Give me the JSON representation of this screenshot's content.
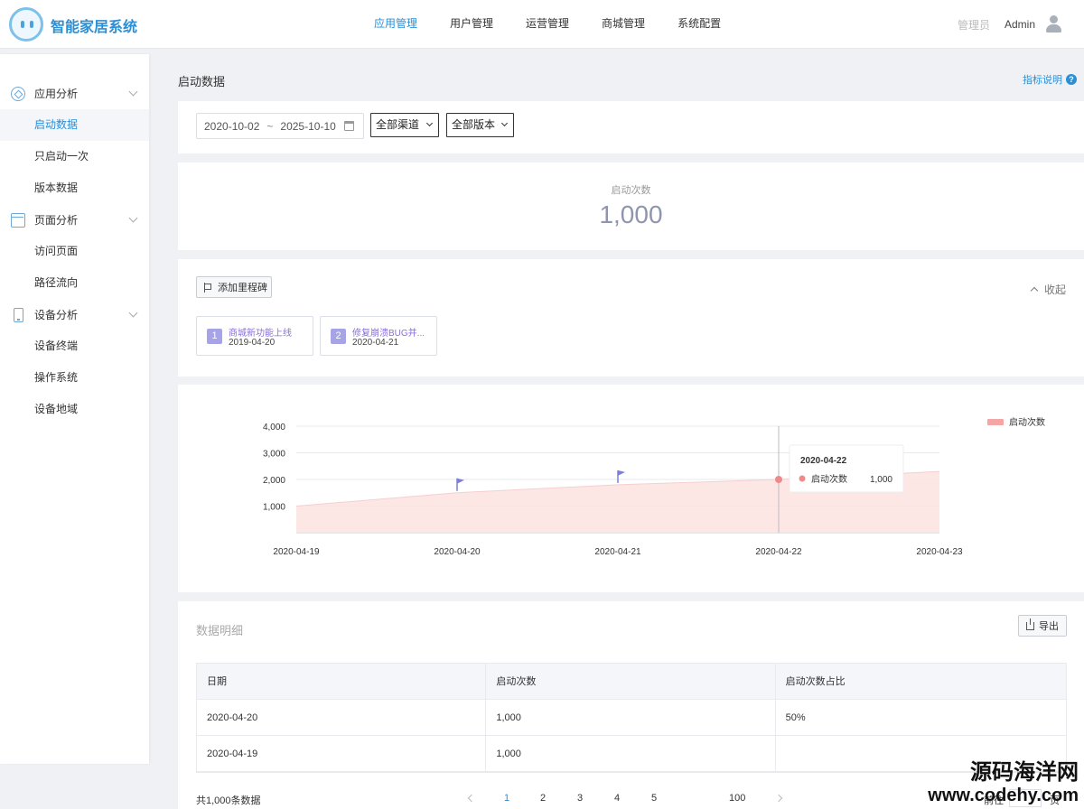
{
  "header": {
    "brand": "智能家居系统",
    "nav": [
      {
        "label": "应用管理",
        "active": true
      },
      {
        "label": "用户管理",
        "active": false
      },
      {
        "label": "运营管理",
        "active": false
      },
      {
        "label": "商城管理",
        "active": false
      },
      {
        "label": "系统配置",
        "active": false
      }
    ],
    "role": "管理员",
    "user": "Admin"
  },
  "sidebar": {
    "groups": [
      {
        "label": "应用分析",
        "icon": "cube-icon",
        "items": [
          "启动数据",
          "只启动一次",
          "版本数据"
        ]
      },
      {
        "label": "页面分析",
        "icon": "window-icon",
        "items": [
          "访问页面",
          "路径流向"
        ]
      },
      {
        "label": "设备分析",
        "icon": "phone-icon",
        "items": [
          "设备终端",
          "操作系统",
          "设备地域"
        ]
      }
    ],
    "active_item": "启动数据"
  },
  "page": {
    "title": "启动数据",
    "help": "指标说明"
  },
  "filters": {
    "date_start": "2020-10-02",
    "date_sep": "~",
    "date_end": "2025-10-10",
    "channel": "全部渠道",
    "version": "全部版本"
  },
  "kpi": {
    "label": "启动次数",
    "value": "1,000"
  },
  "milestones": {
    "add_label": "添加里程碑",
    "collapse_label": "收起",
    "items": [
      {
        "num": "1",
        "title": "商城新功能上线",
        "date": "2019-04-20"
      },
      {
        "num": "2",
        "title": "修复崩溃BUG并...",
        "date": "2020-04-21"
      }
    ]
  },
  "chart_data": {
    "type": "area",
    "x": [
      "2020-04-19",
      "2020-04-20",
      "2020-04-21",
      "2020-04-22",
      "2020-04-23"
    ],
    "series": [
      {
        "name": "启动次数",
        "values": [
          1000,
          1500,
          1800,
          2000,
          2300
        ],
        "color": "#f4a6a6"
      }
    ],
    "ylim": [
      0,
      4000
    ],
    "yticks": [
      "1,000",
      "2,000",
      "3,000",
      "4,000"
    ],
    "yticks_values": [
      1000,
      2000,
      3000,
      4000
    ],
    "grid": true,
    "legend": "top-right",
    "milestone_flags": [
      "2020-04-20",
      "2020-04-21"
    ],
    "tooltip": {
      "date": "2020-04-22",
      "label": "启动次数",
      "value": "1,000"
    }
  },
  "detail": {
    "title": "数据明细",
    "export_label": "导出",
    "columns": [
      "日期",
      "启动次数",
      "启动次数占比"
    ],
    "rows": [
      [
        "2020-04-20",
        "1,000",
        "50%"
      ],
      [
        "2020-04-19",
        "1,000",
        ""
      ]
    ],
    "total": "共1,000条数据",
    "pages": [
      "1",
      "2",
      "3",
      "4",
      "5",
      "100"
    ],
    "current_page": "1",
    "goto_label": "前往",
    "page_unit": "页"
  },
  "watermark": {
    "line1": "源码海洋网",
    "line2": "www.codehy.com"
  }
}
